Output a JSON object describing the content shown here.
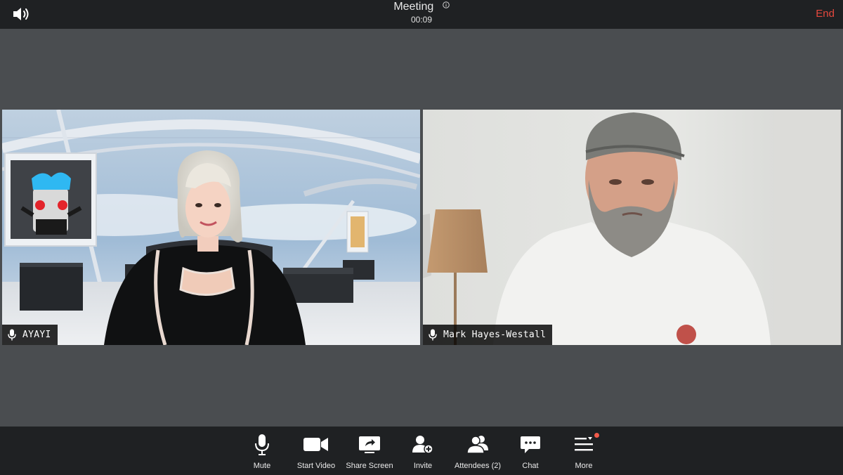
{
  "header": {
    "title": "Meeting",
    "timer": "00:09",
    "end_label": "End",
    "icons": {
      "speaker": "speaker-icon",
      "info": "info-icon"
    },
    "end_color": "#e5483e"
  },
  "participants": [
    {
      "name": "AYAYI",
      "icon": "microphone-icon"
    },
    {
      "name": "Mark Hayes-Westall",
      "icon": "microphone-icon"
    }
  ],
  "toolbar": {
    "items": [
      {
        "label": "Mute",
        "icon": "microphone-icon"
      },
      {
        "label": "Start Video",
        "icon": "video-camera-icon"
      },
      {
        "label": "Share Screen",
        "icon": "share-screen-icon"
      },
      {
        "label": "Invite",
        "icon": "add-person-icon"
      },
      {
        "label": "Attendees",
        "icon": "attendees-icon",
        "count": "(2)"
      },
      {
        "label": "Chat",
        "icon": "chat-bubble-icon"
      },
      {
        "label": "More",
        "icon": "more-menu-icon"
      }
    ],
    "notification_color": "#f25a4a"
  },
  "colors": {
    "stage_background": "#4a4d50",
    "bar_background": "#1f2123"
  }
}
